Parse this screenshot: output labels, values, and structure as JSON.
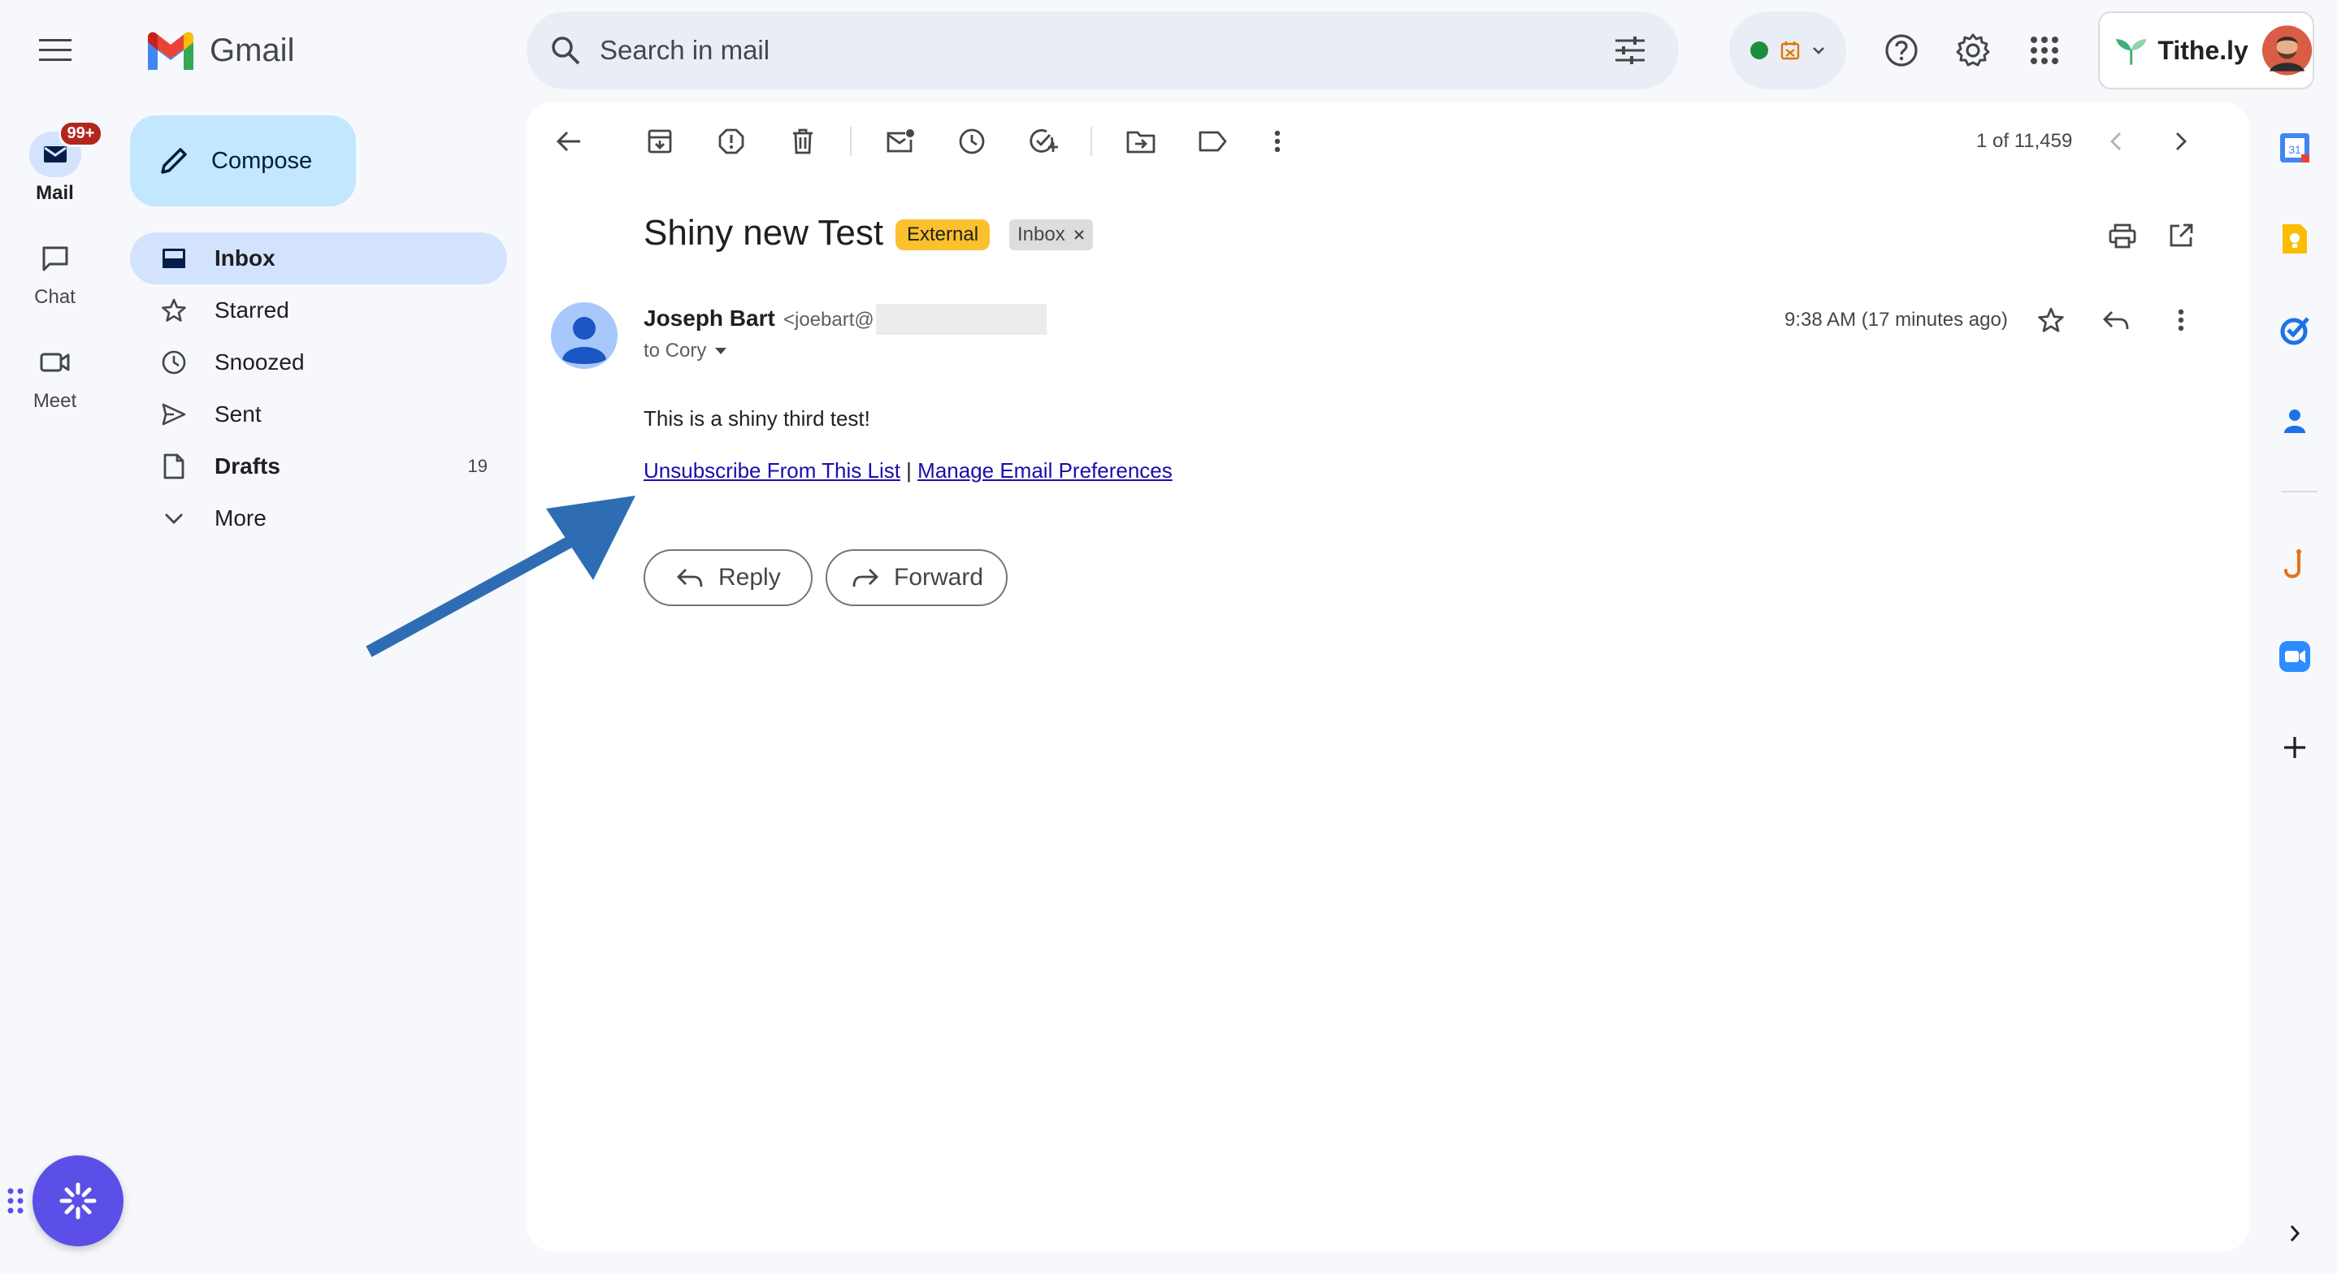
{
  "app": {
    "name": "Gmail"
  },
  "rail": {
    "mail_label": "Mail",
    "mail_badge": "99+",
    "chat_label": "Chat",
    "meet_label": "Meet"
  },
  "nav": {
    "compose_label": "Compose",
    "items": [
      {
        "label": "Inbox",
        "icon": "inbox-icon",
        "count": ""
      },
      {
        "label": "Starred",
        "icon": "star-icon",
        "count": ""
      },
      {
        "label": "Snoozed",
        "icon": "clock-icon",
        "count": ""
      },
      {
        "label": "Sent",
        "icon": "send-icon",
        "count": ""
      },
      {
        "label": "Drafts",
        "icon": "draft-icon",
        "count": "19"
      },
      {
        "label": "More",
        "icon": "chevron-down-icon",
        "count": ""
      }
    ]
  },
  "search": {
    "placeholder": "Search in mail"
  },
  "account": {
    "brand": "Tithe.ly"
  },
  "toolbar": {
    "pagination": "1 of 11,459"
  },
  "email": {
    "subject": "Shiny new Test",
    "label_external": "External",
    "label_inbox": "Inbox",
    "sender_name": "Joseph Bart",
    "sender_email": "<joebart@",
    "to": "to Cory",
    "time": "9:38 AM (17 minutes ago)",
    "body": "This is a shiny third test!",
    "link_unsubscribe": "Unsubscribe From This List",
    "link_separator": " | ",
    "link_preferences": "Manage Email Preferences"
  },
  "actions": {
    "reply_label": "Reply",
    "forward_label": "Forward"
  },
  "colors": {
    "accent": "#0b57d0",
    "compose_bg": "#c2e7ff",
    "nav_active": "#d3e3fd",
    "badge": "#b3261e",
    "external_chip": "#fbc02d",
    "annotation_arrow": "#2e6db4",
    "fab": "#5b4fe8"
  }
}
